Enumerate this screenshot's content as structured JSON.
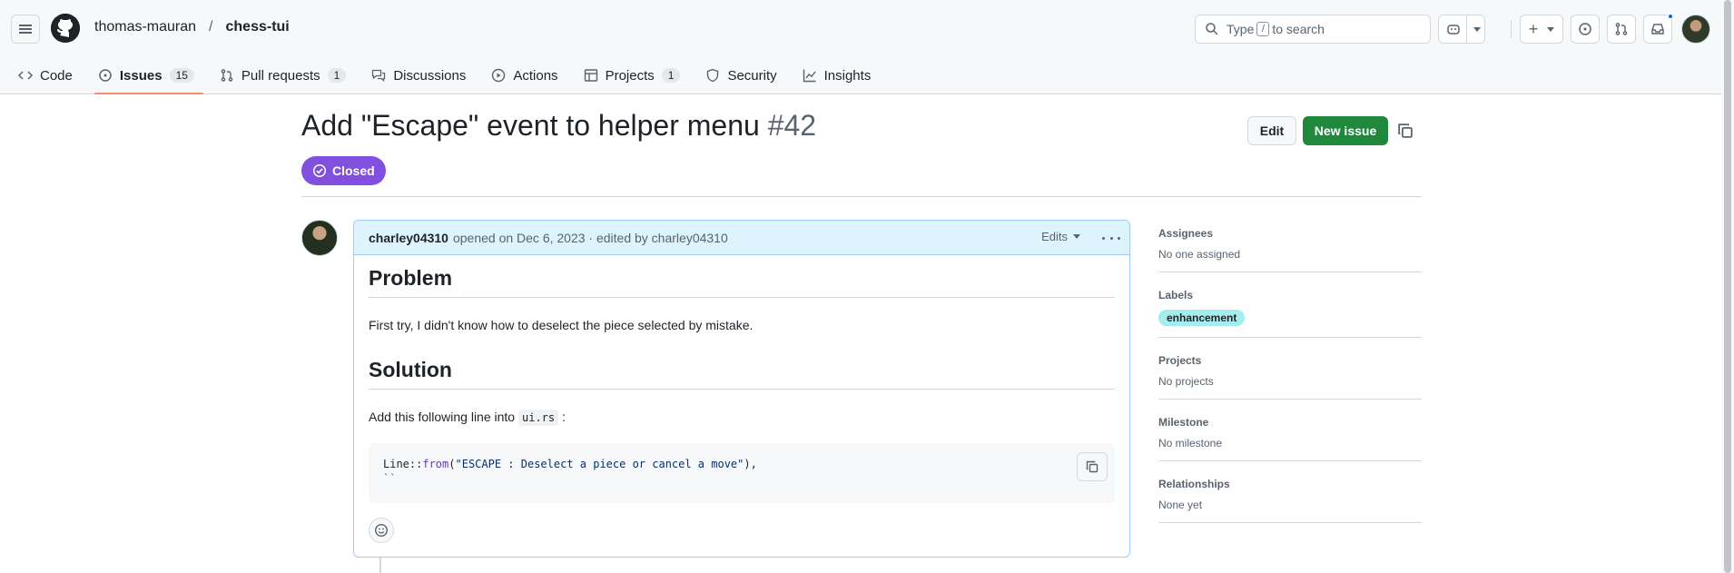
{
  "header": {
    "owner": "thomas-mauran",
    "separator": "/",
    "repo": "chess-tui",
    "search": {
      "prefix": "Type",
      "key": "/",
      "suffix": "to search"
    }
  },
  "tabs": [
    {
      "label": "Code",
      "icon": "code-icon"
    },
    {
      "label": "Issues",
      "icon": "issue-opened-icon",
      "count": "15",
      "active": true
    },
    {
      "label": "Pull requests",
      "icon": "git-pull-request-icon",
      "count": "1"
    },
    {
      "label": "Discussions",
      "icon": "comment-discussion-icon"
    },
    {
      "label": "Actions",
      "icon": "play-icon"
    },
    {
      "label": "Projects",
      "icon": "table-icon",
      "count": "1"
    },
    {
      "label": "Security",
      "icon": "shield-icon"
    },
    {
      "label": "Insights",
      "icon": "graph-icon"
    }
  ],
  "issue": {
    "title": "Add \"Escape\" event to helper menu",
    "number": "#42",
    "state": "Closed",
    "state_color": "#8250df",
    "edit_label": "Edit",
    "new_issue_label": "New issue"
  },
  "comment": {
    "author": "charley04310",
    "meta": "opened on Dec 6, 2023 · edited by charley04310",
    "edits_label": "Edits",
    "h_problem": "Problem",
    "problem_text": "First try, I didn't know how to deselect the piece selected by mistake.",
    "h_solution": "Solution",
    "solution_text": "Add this following line into",
    "solution_code": "ui.rs",
    "solution_after": ":",
    "code_prefix": "Line::",
    "code_fn": "from",
    "code_open": "(",
    "code_string": "\"ESCAPE : Deselect a piece or cancel a move\"",
    "code_close": "),",
    "code_line2": "``"
  },
  "sidebar": {
    "assignees_title": "Assignees",
    "assignees_value": "No one assigned",
    "labels_title": "Labels",
    "label_name": "enhancement",
    "projects_title": "Projects",
    "projects_value": "No projects",
    "milestone_title": "Milestone",
    "milestone_value": "No milestone",
    "relationships_title": "Relationships",
    "relationships_value": "None yet"
  },
  "colors": {
    "accent_green": "#1f883d",
    "closed_purple": "#8250df",
    "label_bg": "#a2eeef",
    "comment_header": "#ddf4ff"
  }
}
